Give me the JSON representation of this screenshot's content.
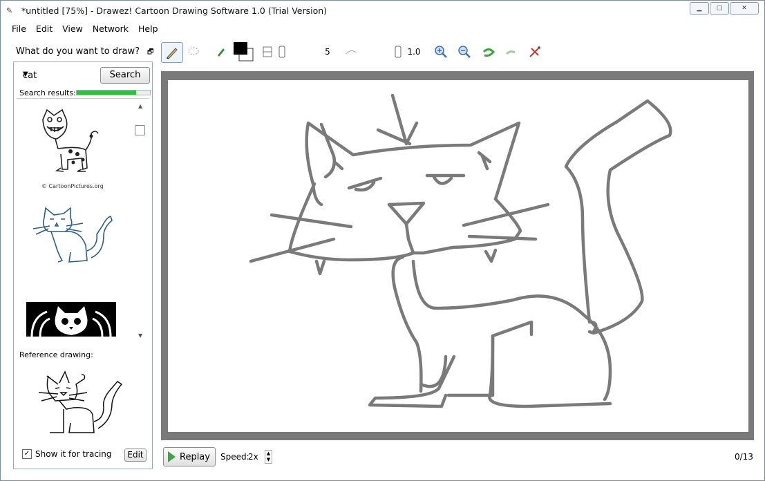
{
  "window": {
    "title": "*untitled [75%] - Drawez! Cartoon Drawing Software 1.0 (Trial Version)",
    "app_icon": "pencil-app-icon"
  },
  "menu": [
    "File",
    "Edit",
    "View",
    "Network",
    "Help"
  ],
  "side_panel": {
    "heading": "What do you want to draw?",
    "search": {
      "value": "cat",
      "button": "Search"
    },
    "results_label": "Search results:",
    "progress": 0.81,
    "results": [
      {
        "credit": "© CartoonPictures.org",
        "checked": false
      },
      {
        "credit": ""
      },
      {
        "credit": ""
      }
    ],
    "reference_label": "Reference drawing:",
    "tracing": {
      "label": "Show it for tracing",
      "checked": true
    },
    "edit_button": "Edit"
  },
  "toolbar": {
    "brush_size": "5",
    "opacity": "1.0",
    "colors": {
      "primary": "#000000",
      "secondary": "#ffffff",
      "accent_progress": "#2ec23a",
      "stroke": "#7a7a7a"
    }
  },
  "bottom": {
    "replay_label": "Replay",
    "speed_label": "Speed:",
    "speed_value": "2x",
    "counter": "0/13"
  }
}
